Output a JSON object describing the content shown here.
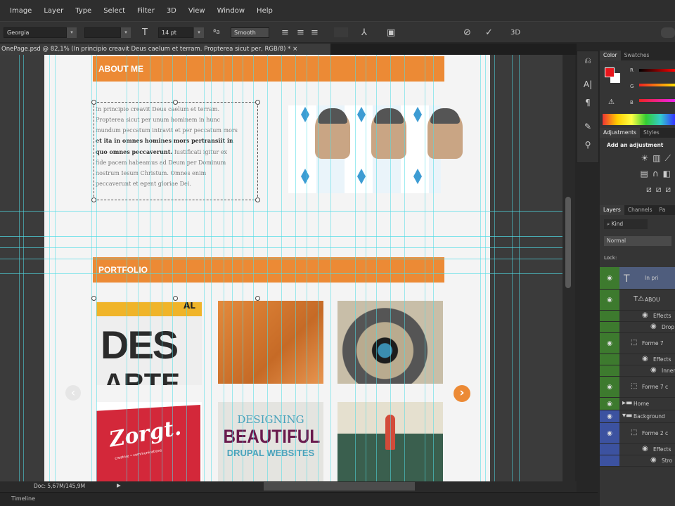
{
  "menu": [
    "Image",
    "Layer",
    "Type",
    "Select",
    "Filter",
    "3D",
    "View",
    "Window",
    "Help"
  ],
  "options": {
    "font_family": "Georgia",
    "font_style": "",
    "font_size": "14 pt",
    "antialias": "Smooth",
    "dd": "▾"
  },
  "document_tab": {
    "title": "OnePage.psd @ 82,1% (In principio creavit Deus caelum et terram. Propterea sicut per, RGB/8) *",
    "close": "×"
  },
  "page": {
    "about_title": "ABOUT ME",
    "portfolio_title": "PORTFOLIO",
    "paragraph_lines": [
      "In principio creavit Deus caelum et terram.",
      "Propterea sicut per unum hominem in hunc",
      "mundum peccatum intravit et per peccatum mors",
      "et ita in omnes homines mors pertransiit in",
      "quo omnes peccaverunt.",
      "Iustificati igitur ex",
      "fide pacem habeamus ad Deum per Dominum",
      "nostrum Iesum Christum. Omnes enim",
      "peccaverunt et egent gloriae Dei."
    ],
    "thumbs": {
      "des": "DES",
      "des2": "ARTE",
      "al": "AL",
      "zorgt": "Zorgt.",
      "zorgt_sub": "creative • communications",
      "designing": "DESIGNING",
      "beautiful": "BEAUTIFUL",
      "drupal": "DRUPAL WEBSITES"
    },
    "prev": "‹",
    "next": "›"
  },
  "color_panel": {
    "tabs": [
      "Color",
      "Swatches"
    ],
    "labels": [
      "R",
      "G",
      "B"
    ],
    "fg": "#e8151b",
    "bg": "#ffffff"
  },
  "adjust_panel": {
    "tabs": [
      "Adjustments",
      "Styles"
    ],
    "heading": "Add an adjustment"
  },
  "layers_panel": {
    "tabs": [
      "Layers",
      "Channels",
      "Pa"
    ],
    "kind": "Kind",
    "blend": "Normal",
    "lock": "Lock:",
    "layers": [
      {
        "name": "In pri",
        "type": "text",
        "color": "#3d7a2e",
        "selected": true
      },
      {
        "name": "ABOU",
        "type": "text-warn",
        "color": "#3d7a2e"
      },
      {
        "name": "Effects",
        "type": "sub",
        "color": "#3d7a2e"
      },
      {
        "name": "Drop",
        "type": "sub2",
        "color": "#3d7a2e"
      },
      {
        "name": "Forme 7",
        "type": "shape",
        "color": "#3d7a2e"
      },
      {
        "name": "Effects",
        "type": "sub",
        "color": "#3d7a2e"
      },
      {
        "name": "Inner",
        "type": "sub2",
        "color": "#3d7a2e"
      },
      {
        "name": "Forme 7 c",
        "type": "shape",
        "color": "#3d7a2e"
      },
      {
        "name": "Home",
        "type": "group",
        "color": "#3d7a2e"
      },
      {
        "name": "Background",
        "type": "group-open",
        "color": "#3c52a0"
      },
      {
        "name": "Forme 2 c",
        "type": "shape",
        "color": "#3c52a0"
      },
      {
        "name": "Effects",
        "type": "sub",
        "color": "#3c52a0"
      },
      {
        "name": "Stro",
        "type": "sub2",
        "color": "#3c52a0"
      }
    ]
  },
  "status": {
    "doc": "Doc: 5,67M/145,9M"
  },
  "timeline": {
    "label": "Timeline"
  }
}
